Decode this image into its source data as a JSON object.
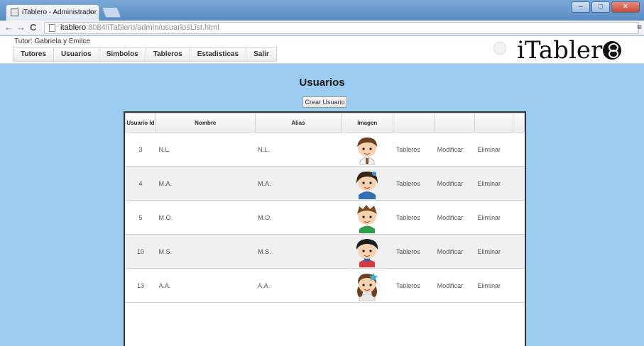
{
  "browser": {
    "tab_title": "iTablero - Administrador",
    "tab_close": "×",
    "url_host": "itablero",
    "url_rest": ":8084/iTablero/admin/usuariosList.html",
    "back_icon": "←",
    "forward_icon": "→",
    "reload_icon": "C",
    "menu_icon": "≡"
  },
  "header": {
    "tutor": "Tutor: Gabriela y Emilce",
    "nav": [
      "Tutores",
      "Usuarios",
      "Simbolos",
      "Tableros",
      "Estadisticas",
      "Salir"
    ],
    "logo": "iTabler"
  },
  "page": {
    "title": "Usuarios",
    "create_button": "Crear Usuario"
  },
  "table": {
    "columns": [
      "Usuario Id",
      "Nombre",
      "Alias",
      "Imagen",
      "",
      "",
      ""
    ],
    "rows": [
      {
        "id": "3",
        "nombre": "N.L.",
        "alias": "N.L.",
        "avatar": "boy-avatar-1",
        "tableros": "Tableros",
        "modificar": "Modificar",
        "eliminar": "Eliminar"
      },
      {
        "id": "4",
        "nombre": "M.A.",
        "alias": "M.A.",
        "avatar": "girl-avatar-1",
        "tableros": "Tableros",
        "modificar": "Modificar",
        "eliminar": "Eliminar"
      },
      {
        "id": "5",
        "nombre": "M.O.",
        "alias": "M.O.",
        "avatar": "boy-avatar-2",
        "tableros": "Tableros",
        "modificar": "Modificar",
        "eliminar": "Eliminar"
      },
      {
        "id": "10",
        "nombre": "M.S.",
        "alias": "M.S.",
        "avatar": "boy-avatar-3",
        "tableros": "Tableros",
        "modificar": "Modificar",
        "eliminar": "Eliminar"
      },
      {
        "id": "13",
        "nombre": "A.A.",
        "alias": "A.A.",
        "avatar": "girl-avatar-2",
        "tableros": "Tableros",
        "modificar": "Modificar",
        "eliminar": "Eliminar"
      }
    ]
  },
  "colors": {
    "page_background": "#9cccef",
    "header_background": "#ffffff"
  }
}
